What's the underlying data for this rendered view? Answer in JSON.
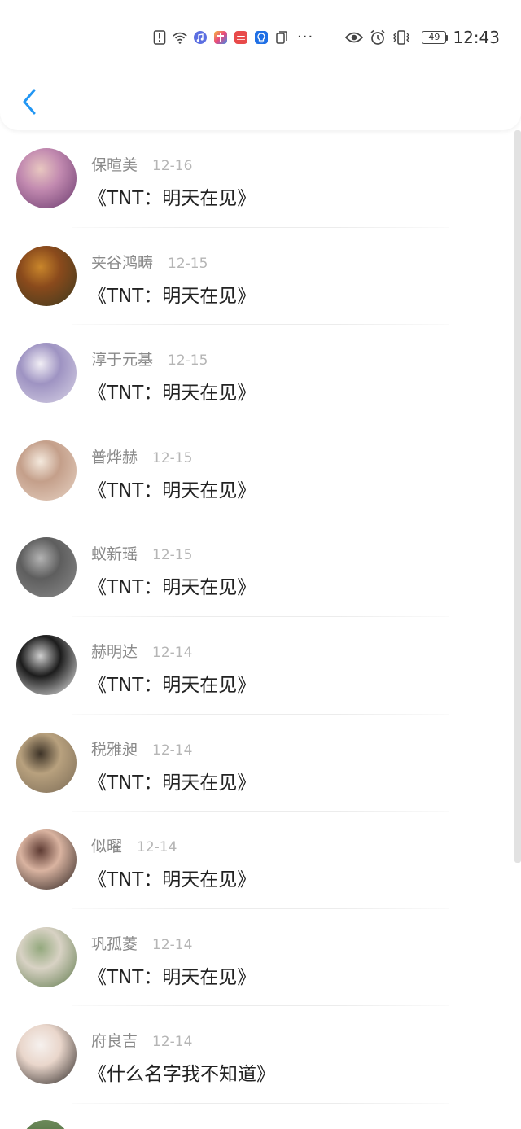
{
  "status_bar": {
    "time": "12:43",
    "battery": "49",
    "more": "···",
    "icons_left": [
      "alert-icon",
      "wifi-icon",
      "music-app-icon",
      "app-store-icon",
      "huawei-app-icon",
      "bulb-app-icon",
      "clipboard-icon"
    ],
    "icons_right": [
      "eye-icon",
      "alarm-icon",
      "vibrate-icon",
      "battery-icon"
    ]
  },
  "header": {
    "back_icon": "chevron-left-icon",
    "accent": "#2196f3"
  },
  "items": [
    {
      "name": "保暄美",
      "date": "12-16",
      "message": "《TNT：明天在见》",
      "avatar_colors": [
        "#6a3a6e",
        "#c28ab0",
        "#e8c7c0"
      ]
    },
    {
      "name": "夹谷鸿畴",
      "date": "12-15",
      "message": "《TNT：明天在见》",
      "avatar_colors": [
        "#3b3a1e",
        "#8a4a1c",
        "#c9862b"
      ]
    },
    {
      "name": "淳于元基",
      "date": "12-15",
      "message": "《TNT：明天在见》",
      "avatar_colors": [
        "#d9d4e6",
        "#9e93c2",
        "#f1eef5"
      ]
    },
    {
      "name": "普烨赫",
      "date": "12-15",
      "message": "《TNT：明天在见》",
      "avatar_colors": [
        "#e7d3c4",
        "#c49f8a",
        "#f4e9dd"
      ]
    },
    {
      "name": "蚁新瑶",
      "date": "12-15",
      "message": "《TNT：明天在见》",
      "avatar_colors": [
        "#8c8c8c",
        "#5e5e5e",
        "#b3b3b3"
      ]
    },
    {
      "name": "赫明达",
      "date": "12-14",
      "message": "《TNT：明天在见》",
      "avatar_colors": [
        "#f2f2f2",
        "#1c1c1c",
        "#cfcfcf"
      ]
    },
    {
      "name": "税雅昶",
      "date": "12-14",
      "message": "《TNT：明天在见》",
      "avatar_colors": [
        "#7a6a55",
        "#b8a17e",
        "#3e3428"
      ]
    },
    {
      "name": "似曜",
      "date": "12-14",
      "message": "《TNT：明天在见》",
      "avatar_colors": [
        "#2b2220",
        "#d9b3a0",
        "#5e3b33"
      ]
    },
    {
      "name": "巩孤菱",
      "date": "12-14",
      "message": "《TNT：明天在见》",
      "avatar_colors": [
        "#5f7a4c",
        "#d8d2c4",
        "#94a97e"
      ]
    },
    {
      "name": "府良吉",
      "date": "12-14",
      "message": "《什么名字我不知道》",
      "avatar_colors": [
        "#2a2523",
        "#e9d6cb",
        "#f6f1ee"
      ]
    }
  ]
}
